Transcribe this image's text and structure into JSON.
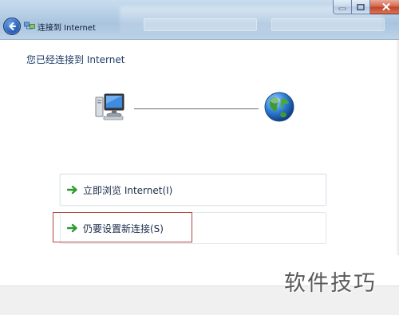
{
  "window": {
    "title": "连接到 Internet",
    "controls": {
      "minimize": "minimize-icon",
      "maximize": "maximize-icon",
      "close": "close-icon"
    }
  },
  "main": {
    "heading": "您已经连接到 Internet",
    "diagram": {
      "left_icon": "computer-icon",
      "right_icon": "globe-icon"
    },
    "links": [
      {
        "label": "立即浏览 Internet(I)",
        "icon": "green-arrow-icon"
      },
      {
        "label": "仍要设置新连接(S)",
        "icon": "green-arrow-icon"
      }
    ]
  },
  "watermark": "软件技巧",
  "colors": {
    "heading": "#1e3b66",
    "link_arrow": "#2f9a2f",
    "highlight_box": "#b24545",
    "title_bar": "#b6cfe6"
  }
}
